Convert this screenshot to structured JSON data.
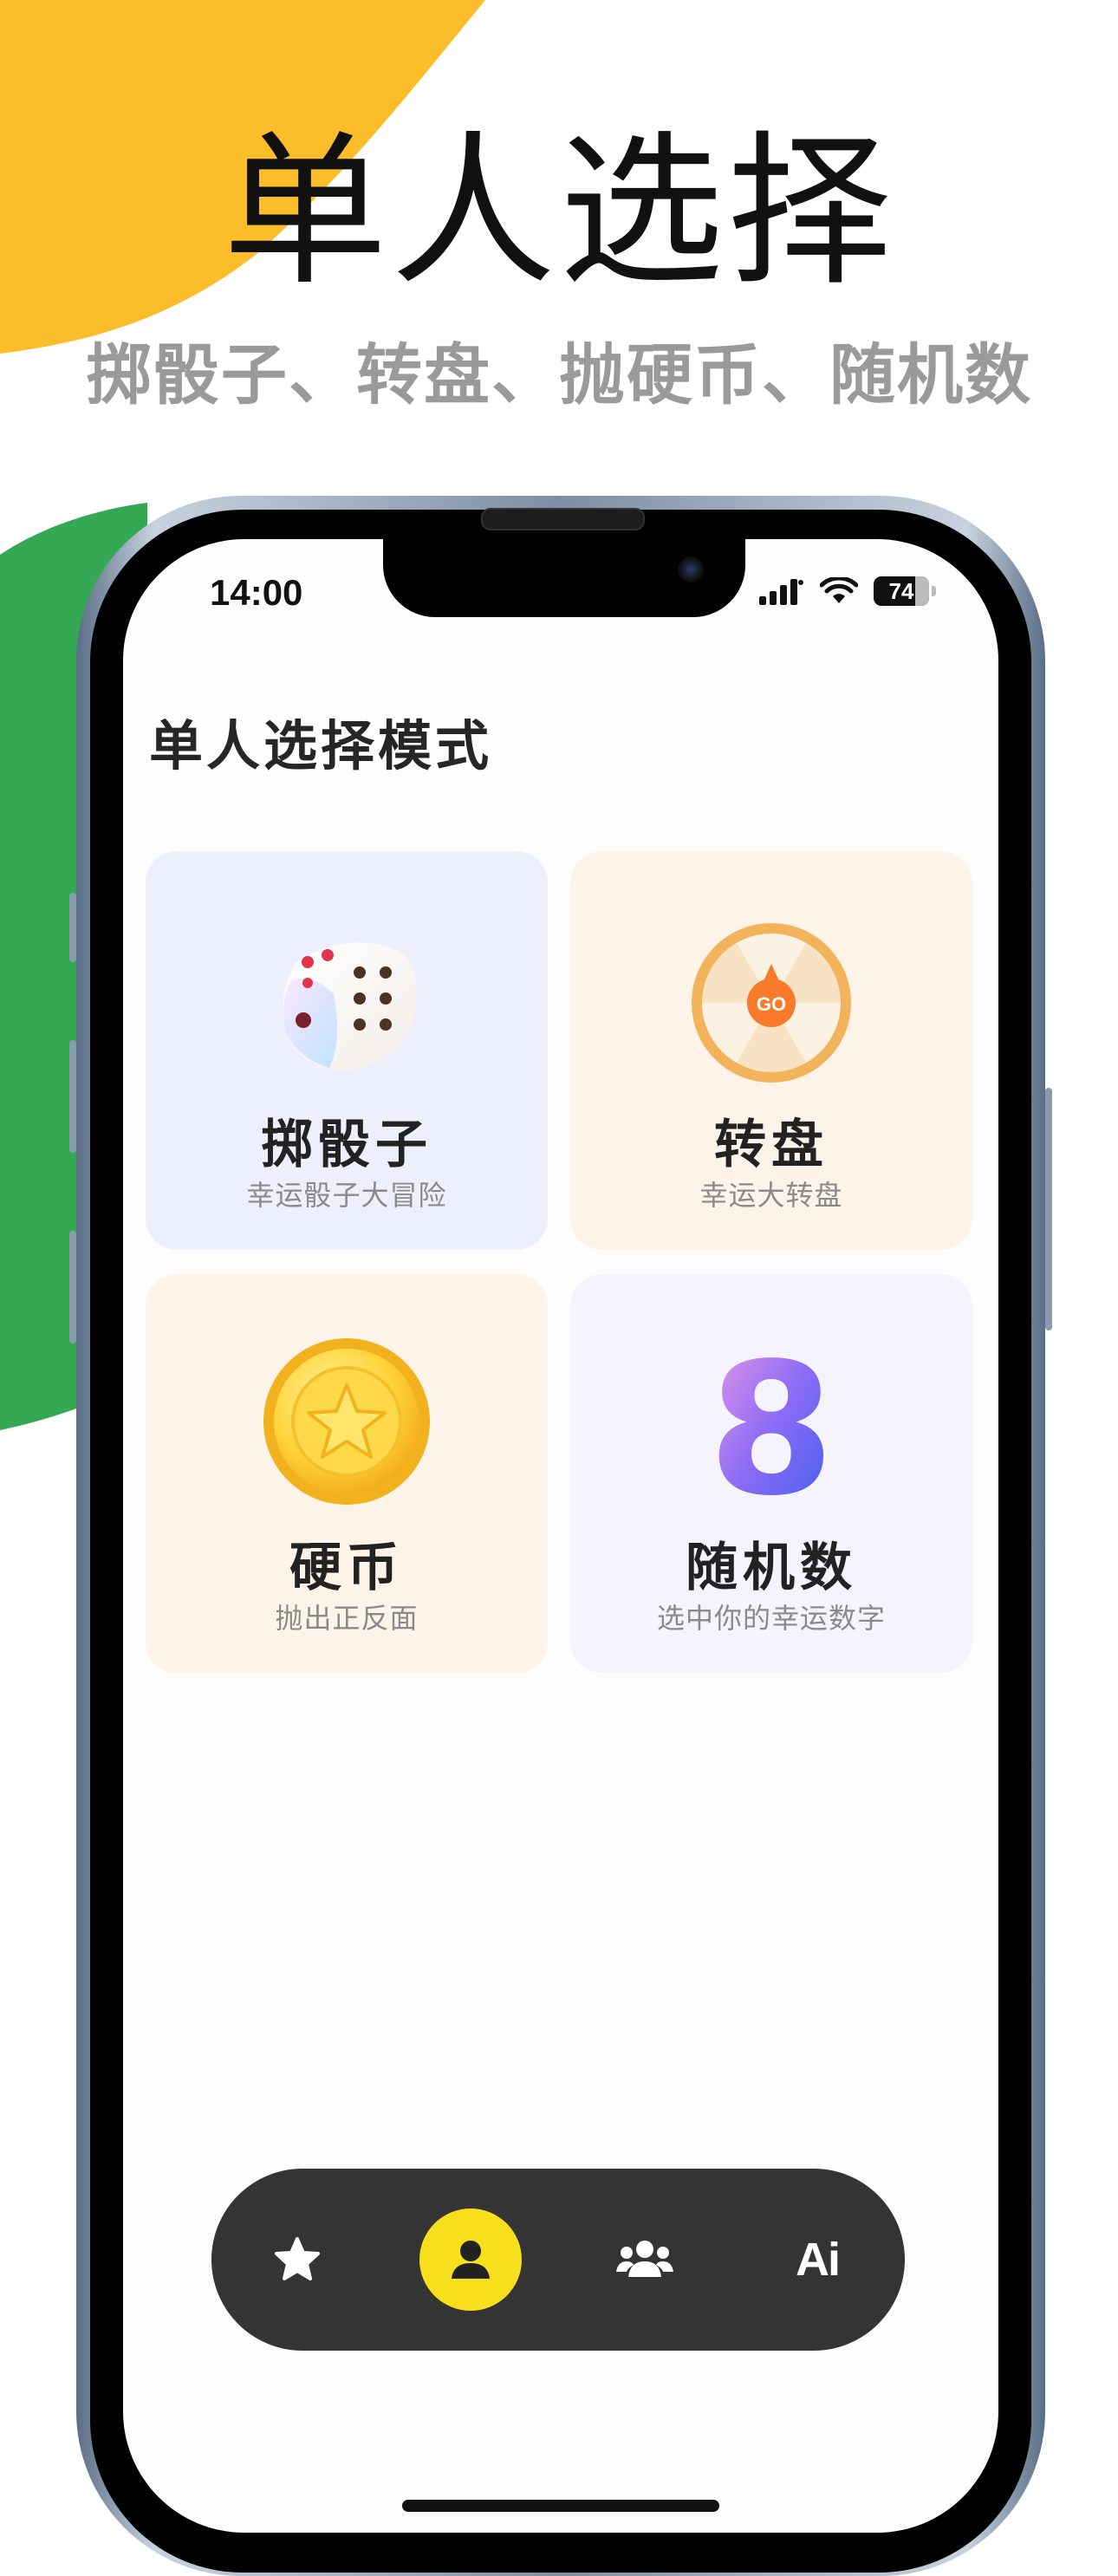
{
  "promo": {
    "title": "单人选择",
    "subtitle": "掷骰子、转盘、抛硬币、随机数"
  },
  "colors": {
    "yellow_blob": "#fbbd2a",
    "green_blob": "#34a853",
    "tabbar_bg": "#343434",
    "tab_active": "#f7df1b"
  },
  "status_bar": {
    "time": "14:00",
    "battery": "74"
  },
  "page": {
    "heading": "单人选择模式"
  },
  "cards": [
    {
      "title": "掷骰子",
      "desc": "幸运骰子大冒险",
      "icon": "dice-icon"
    },
    {
      "title": "转盘",
      "desc": "幸运大转盘",
      "icon": "wheel-icon",
      "wheel_label": "GO"
    },
    {
      "title": "硬币",
      "desc": "抛出正反面",
      "icon": "coin-icon"
    },
    {
      "title": "随机数",
      "desc": "选中你的幸运数字",
      "icon": "number-eight-icon",
      "number": "8"
    }
  ],
  "tabbar": {
    "tabs": [
      {
        "icon": "star-icon",
        "active": false
      },
      {
        "icon": "person-icon",
        "active": true
      },
      {
        "icon": "group-icon",
        "active": false
      },
      {
        "icon": "ai-icon",
        "label": "Ai",
        "active": false
      }
    ]
  }
}
